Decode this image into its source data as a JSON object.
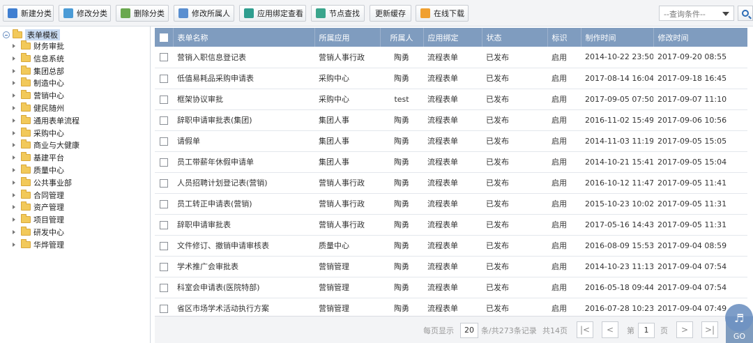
{
  "toolbar": {
    "buttons": [
      {
        "label": "新建分类",
        "icon": "add-folder-icon"
      },
      {
        "label": "修改分类",
        "icon": "edit-folder-icon"
      },
      {
        "label": "删除分类",
        "icon": "trash-icon"
      },
      {
        "label": "修改所属人",
        "icon": "edit-owner-icon"
      },
      {
        "label": "应用绑定查看",
        "icon": "binding-view-icon"
      },
      {
        "label": "节点查找",
        "icon": "node-search-icon"
      },
      {
        "label": "更新缓存",
        "icon": ""
      },
      {
        "label": "在线下载",
        "icon": "cloud-download-icon"
      }
    ],
    "query_select": "--查询条件--"
  },
  "tree": {
    "root": "表单模板",
    "items": [
      "财务审批",
      "信息系统",
      "集团总部",
      "制造中心",
      "营销中心",
      "健民随州",
      "通用表单流程",
      "采购中心",
      "商业与大健康",
      "基建平台",
      "质量中心",
      "公共事业部",
      "合同管理",
      "资产管理",
      "项目管理",
      "研发中心",
      "华烨管理"
    ]
  },
  "grid": {
    "columns": [
      "表单名称",
      "所属应用",
      "所属人",
      "应用绑定",
      "状态",
      "标识",
      "制作时间",
      "修改时间"
    ],
    "rows": [
      {
        "name": "营销入职信息登记表",
        "app": "营销人事行政",
        "owner": "陶勇",
        "binding": "流程表单",
        "status": "已发布",
        "flag": "启用",
        "created": "2014-10-22 23:50",
        "modified": "2017-09-20 08:55"
      },
      {
        "name": "低值易耗品采购申请表",
        "app": "采购中心",
        "owner": "陶勇",
        "binding": "流程表单",
        "status": "已发布",
        "flag": "启用",
        "created": "2017-08-14 16:04",
        "modified": "2017-09-18 16:45"
      },
      {
        "name": "框架协议审批",
        "app": "采购中心",
        "owner": "test",
        "binding": "流程表单",
        "status": "已发布",
        "flag": "启用",
        "created": "2017-09-05 07:50",
        "modified": "2017-09-07 11:10"
      },
      {
        "name": "辞职申请审批表(集团)",
        "app": "集团人事",
        "owner": "陶勇",
        "binding": "流程表单",
        "status": "已发布",
        "flag": "启用",
        "created": "2016-11-02 15:49",
        "modified": "2017-09-06 10:56"
      },
      {
        "name": "请假单",
        "app": "集团人事",
        "owner": "陶勇",
        "binding": "流程表单",
        "status": "已发布",
        "flag": "启用",
        "created": "2014-11-03 11:19",
        "modified": "2017-09-05 15:05"
      },
      {
        "name": "员工带薪年休假申请单",
        "app": "集团人事",
        "owner": "陶勇",
        "binding": "流程表单",
        "status": "已发布",
        "flag": "启用",
        "created": "2014-10-21 15:41",
        "modified": "2017-09-05 15:04"
      },
      {
        "name": "人员招聘计划登记表(营销)",
        "app": "营销人事行政",
        "owner": "陶勇",
        "binding": "流程表单",
        "status": "已发布",
        "flag": "启用",
        "created": "2016-10-12 11:47",
        "modified": "2017-09-05 11:41"
      },
      {
        "name": "员工转正申请表(营销)",
        "app": "营销人事行政",
        "owner": "陶勇",
        "binding": "流程表单",
        "status": "已发布",
        "flag": "启用",
        "created": "2015-10-23 10:02",
        "modified": "2017-09-05 11:31"
      },
      {
        "name": "辞职申请审批表",
        "app": "营销人事行政",
        "owner": "陶勇",
        "binding": "流程表单",
        "status": "已发布",
        "flag": "启用",
        "created": "2017-05-16 14:43",
        "modified": "2017-09-05 11:31"
      },
      {
        "name": "文件修订、撤销申请审核表",
        "app": "质量中心",
        "owner": "陶勇",
        "binding": "流程表单",
        "status": "已发布",
        "flag": "启用",
        "created": "2016-08-09 15:53",
        "modified": "2017-09-04 08:59"
      },
      {
        "name": "学术推广会审批表",
        "app": "营销管理",
        "owner": "陶勇",
        "binding": "流程表单",
        "status": "已发布",
        "flag": "启用",
        "created": "2014-10-23 11:13",
        "modified": "2017-09-04 07:54"
      },
      {
        "name": "科室会申请表(医院特部)",
        "app": "营销管理",
        "owner": "陶勇",
        "binding": "流程表单",
        "status": "已发布",
        "flag": "启用",
        "created": "2016-05-18 09:44",
        "modified": "2017-09-04 07:54"
      },
      {
        "name": "省区市场学术活动执行方案",
        "app": "营销管理",
        "owner": "陶勇",
        "binding": "流程表单",
        "status": "已发布",
        "flag": "启用",
        "created": "2016-07-28 10:23",
        "modified": "2017-09-04 07:49"
      }
    ]
  },
  "pager": {
    "per_page_label": "每页显示",
    "per_page": "20",
    "records_label": "条/共273条记录",
    "pages_label": "共14页",
    "page_prefix": "第",
    "page": "1",
    "page_suffix": "页",
    "go": "GO"
  }
}
